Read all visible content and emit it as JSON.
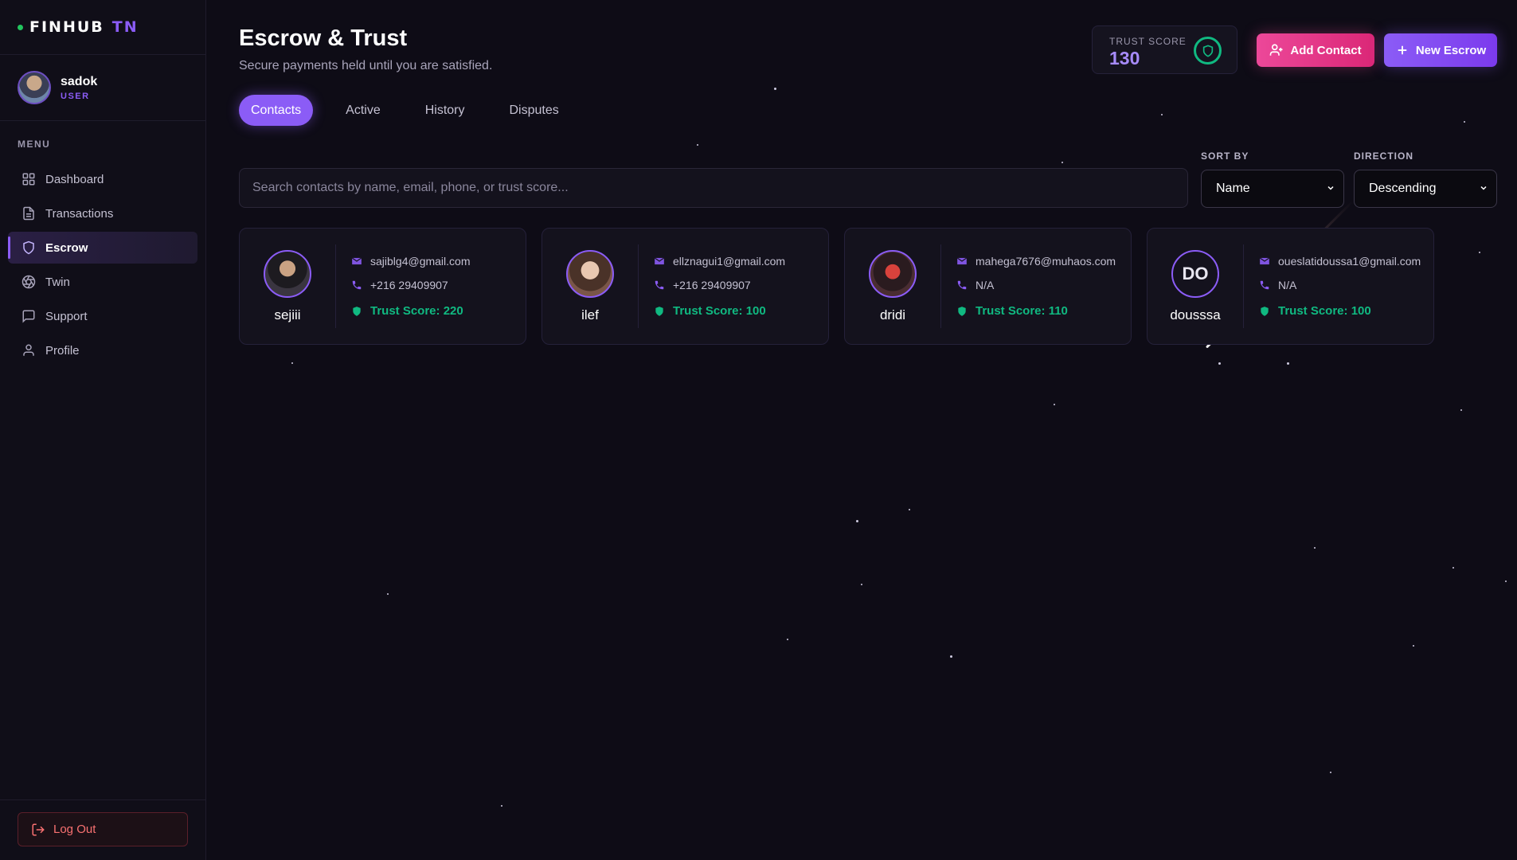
{
  "brand": {
    "name": "FINHUB",
    "accent": "TN"
  },
  "user": {
    "name": "sadok",
    "role": "USER"
  },
  "menu": {
    "label": "MENU",
    "items": [
      {
        "label": "Dashboard",
        "icon": "grid-icon"
      },
      {
        "label": "Transactions",
        "icon": "document-icon"
      },
      {
        "label": "Escrow",
        "icon": "shield-icon",
        "active": true
      },
      {
        "label": "Twin",
        "icon": "aperture-icon"
      },
      {
        "label": "Support",
        "icon": "chat-icon"
      },
      {
        "label": "Profile",
        "icon": "user-icon"
      }
    ]
  },
  "logout_label": "Log Out",
  "header": {
    "title": "Escrow & Trust",
    "subtitle": "Secure payments held until you are satisfied.",
    "trust_score_label": "TRUST SCORE",
    "trust_score_value": "130",
    "add_contact_label": "Add Contact",
    "new_escrow_label": "New Escrow"
  },
  "tabs": [
    {
      "label": "Contacts",
      "active": true
    },
    {
      "label": "Active"
    },
    {
      "label": "History"
    },
    {
      "label": "Disputes"
    }
  ],
  "search": {
    "placeholder": "Search contacts by name, email, phone, or trust score...",
    "value": ""
  },
  "sort": {
    "label": "SORT BY",
    "value": "Name"
  },
  "direction": {
    "label": "DIRECTION",
    "value": "Descending"
  },
  "contacts": [
    {
      "name": "sejiii",
      "email": "sajiblg4@gmail.com",
      "phone": "+216 29409907",
      "trust": "Trust Score: 220",
      "initials": ""
    },
    {
      "name": "ilef",
      "email": "ellznagui1@gmail.com",
      "phone": "+216 29409907",
      "trust": "Trust Score: 100",
      "initials": ""
    },
    {
      "name": "dridi",
      "email": "mahega7676@muhaos.com",
      "phone": "N/A",
      "trust": "Trust Score: 110",
      "initials": ""
    },
    {
      "name": "dousssa",
      "email": "oueslatidoussa1@gmail.com",
      "phone": "N/A",
      "trust": "Trust Score: 100",
      "initials": "DO"
    }
  ],
  "colors": {
    "accent": "#8b5cf6",
    "pink": "#ec4899",
    "success": "#10b981",
    "danger": "#f87171",
    "background": "#0e0c16"
  }
}
